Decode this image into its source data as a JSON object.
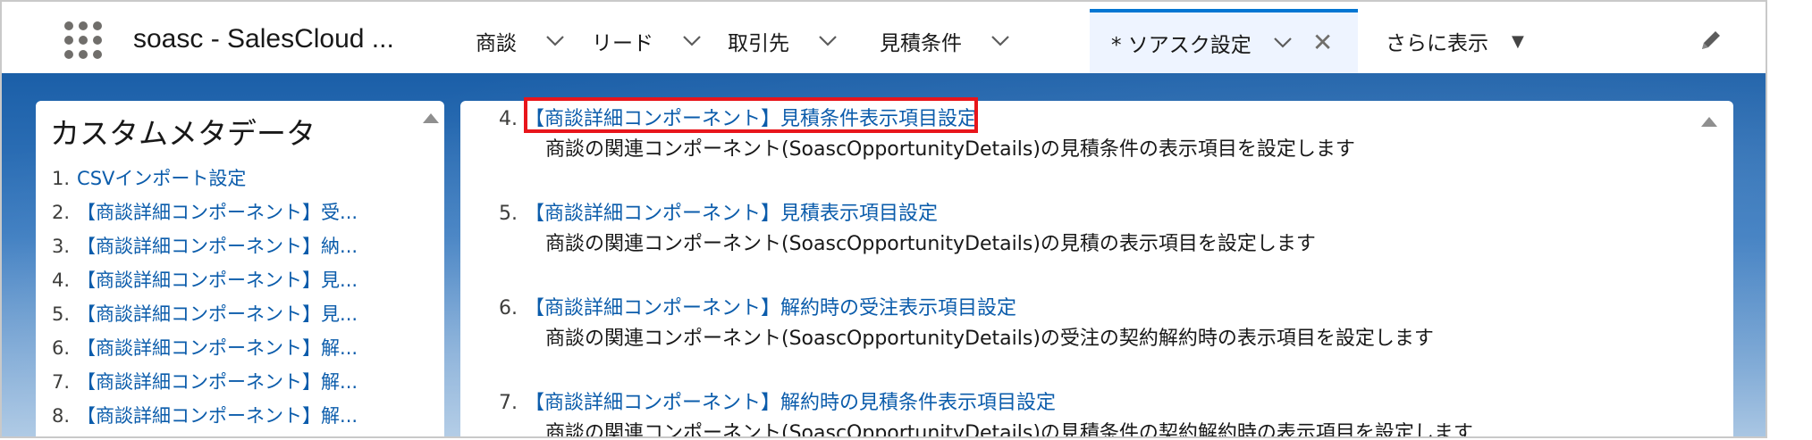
{
  "header": {
    "app_name": "soasc - SalesCloud ...",
    "tabs": [
      {
        "label": "商談"
      },
      {
        "label": "リード"
      },
      {
        "label": "取引先"
      },
      {
        "label": "見積条件"
      },
      {
        "label": "* ソアスク設定"
      },
      {
        "label": "さらに表示"
      }
    ]
  },
  "sidebar": {
    "title": "カスタムメタデータ",
    "items": [
      {
        "num": "1.",
        "label": "CSVインポート設定"
      },
      {
        "num": "2.",
        "label": "【商談詳細コンポーネント】受..."
      },
      {
        "num": "3.",
        "label": "【商談詳細コンポーネント】納..."
      },
      {
        "num": "4.",
        "label": "【商談詳細コンポーネント】見..."
      },
      {
        "num": "5.",
        "label": "【商談詳細コンポーネント】見..."
      },
      {
        "num": "6.",
        "label": "【商談詳細コンポーネント】解..."
      },
      {
        "num": "7.",
        "label": "【商談詳細コンポーネント】解..."
      },
      {
        "num": "8.",
        "label": "【商談詳細コンポーネント】解..."
      }
    ]
  },
  "main": {
    "entries": [
      {
        "num": "4.",
        "title": "【商談詳細コンポーネント】見積条件表示項目設定",
        "desc": "商談の関連コンポーネント(SoascOpportunityDetails)の見積条件の表示項目を設定します"
      },
      {
        "num": "5.",
        "title": "【商談詳細コンポーネント】見積表示項目設定",
        "desc": "商談の関連コンポーネント(SoascOpportunityDetails)の見積の表示項目を設定します"
      },
      {
        "num": "6.",
        "title": "【商談詳細コンポーネント】解約時の受注表示項目設定",
        "desc": "商談の関連コンポーネント(SoascOpportunityDetails)の受注の契約解約時の表示項目を設定します"
      },
      {
        "num": "7.",
        "title": "【商談詳細コンポーネント】解約時の見積条件表示項目設定",
        "desc": "商談の関連コンポーネント(SoascOpportunityDetails)の見積条件の契約解約時の表示項目を設定します"
      }
    ]
  },
  "icons": [
    "app-launcher-icon",
    "chevron-down-icon",
    "close-icon",
    "caret-down-icon",
    "pencil-icon",
    "scroll-up-icon"
  ],
  "colors": {
    "link": "#0b5cab",
    "active_tab_bar": "#0176d3",
    "highlight": "#e8151b"
  }
}
